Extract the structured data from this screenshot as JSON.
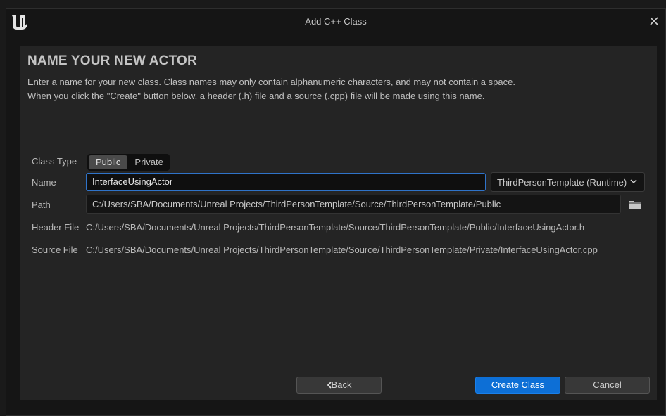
{
  "window": {
    "title": "Add C++ Class"
  },
  "icons": {
    "logo": "unreal-engine-logo",
    "close": "close-icon",
    "chevron": "chevron-down-icon",
    "folder": "folder-icon",
    "back_arrow": "chevron-left-icon"
  },
  "main": {
    "heading": "NAME YOUR NEW ACTOR",
    "description_line1": "Enter a name for your new class. Class names may only contain alphanumeric characters, and may not contain a space.",
    "description_line2": "When you click the \"Create\" button below, a header (.h) file and a source (.cpp) file will be made using this name."
  },
  "form": {
    "class_type_label": "Class Type",
    "class_type_options": [
      "Public",
      "Private"
    ],
    "class_type_selected": "Public",
    "name_label": "Name",
    "name_value": "InterfaceUsingActor",
    "module_value": "ThirdPersonTemplate (Runtime)",
    "path_label": "Path",
    "path_value": "C:/Users/SBA/Documents/Unreal Projects/ThirdPersonTemplate/Source/ThirdPersonTemplate/Public",
    "header_file_label": "Header File",
    "header_file_value": "C:/Users/SBA/Documents/Unreal Projects/ThirdPersonTemplate/Source/ThirdPersonTemplate/Public/InterfaceUsingActor.h",
    "source_file_label": "Source File",
    "source_file_value": "C:/Users/SBA/Documents/Unreal Projects/ThirdPersonTemplate/Source/ThirdPersonTemplate/Private/InterfaceUsingActor.cpp"
  },
  "buttons": {
    "back": "Back",
    "create": "Create Class",
    "cancel": "Cancel"
  },
  "colors": {
    "accent": "#0d6fd6",
    "focus_border": "#2f73c9",
    "panel_bg": "#242424",
    "window_bg": "#151515"
  }
}
